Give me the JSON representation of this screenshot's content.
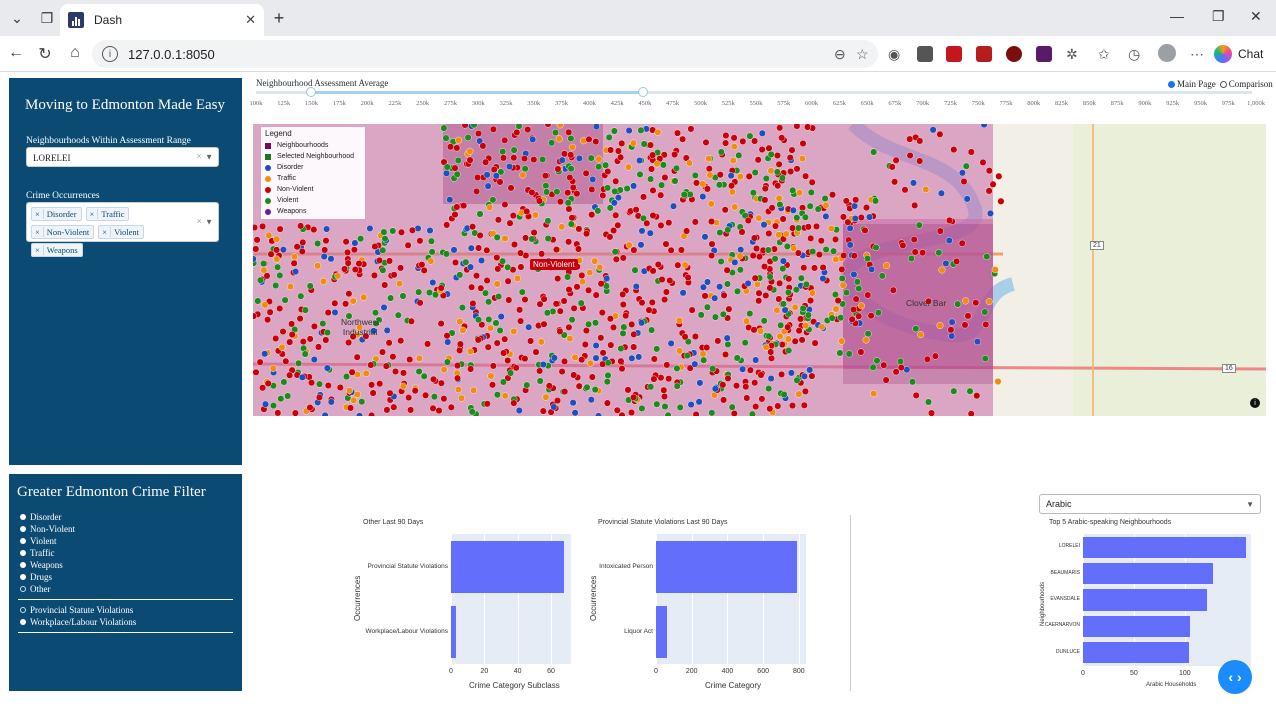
{
  "browser": {
    "tab_title": "Dash",
    "url": "127.0.0.1:8050",
    "chat_label": "Chat"
  },
  "sidebar": {
    "title": "Moving to Edmonton Made Easy",
    "range_label": "Neighbourhoods Within Assessment Range",
    "neighbourhood_value": "LORELEI",
    "crime_label": "Crime Occurrences",
    "crime_chips": [
      "Disorder",
      "Traffic",
      "Non-Violent",
      "Violent",
      "Weapons"
    ]
  },
  "filter": {
    "title": "Greater Edmonton Crime Filter",
    "options": [
      {
        "label": "Disorder",
        "selected": false
      },
      {
        "label": "Non-Violent",
        "selected": false
      },
      {
        "label": "Violent",
        "selected": false
      },
      {
        "label": "Traffic",
        "selected": false
      },
      {
        "label": "Weapons",
        "selected": false
      },
      {
        "label": "Drugs",
        "selected": false
      },
      {
        "label": "Other",
        "selected": true
      }
    ],
    "sub_options": [
      {
        "label": "Provincial Statute Violations",
        "selected": true
      },
      {
        "label": "Workplace/Labour Violations",
        "selected": false
      }
    ]
  },
  "slider": {
    "title": "Neighbourhood Assessment Average",
    "ticks": [
      "100k",
      "125k",
      "150k",
      "175k",
      "200k",
      "225k",
      "250k",
      "275k",
      "300k",
      "325k",
      "350k",
      "375k",
      "400k",
      "425k",
      "450k",
      "475k",
      "500k",
      "525k",
      "550k",
      "575k",
      "600k",
      "625k",
      "650k",
      "675k",
      "700k",
      "725k",
      "750k",
      "775k",
      "800k",
      "825k",
      "850k",
      "875k",
      "900k",
      "925k",
      "950k",
      "975k",
      "1,000k"
    ],
    "value_low": "150k",
    "value_high": "450k"
  },
  "modes": {
    "main": "Main Page",
    "comparison": "Comparison",
    "selected": "main"
  },
  "map": {
    "legend_title": "Legend",
    "legend": [
      {
        "label": "Neighbourhoods",
        "color": "#7a0a55",
        "shape": "square"
      },
      {
        "label": "Selected Neighbourhood",
        "color": "#1a7a1a",
        "shape": "square"
      },
      {
        "label": "Disorder",
        "color": "#1f4fbf",
        "shape": "circle"
      },
      {
        "label": "Traffic",
        "color": "#f28c0f",
        "shape": "circle"
      },
      {
        "label": "Non-Violent",
        "color": "#c7000a",
        "shape": "circle"
      },
      {
        "label": "Violent",
        "color": "#1c8a1c",
        "shape": "circle"
      },
      {
        "label": "Weapons",
        "color": "#6a1b9a",
        "shape": "circle"
      }
    ],
    "hover_label": "Non-Violent",
    "places": [
      "Northwest\nIndustrial",
      "Clover Bar"
    ],
    "shields": [
      "21",
      "16"
    ]
  },
  "chart_data": [
    {
      "type": "bar",
      "orientation": "horizontal",
      "title": "Other Last 90 Days",
      "categories": [
        "Provincial Statute Violations",
        "Workplace/Labour Violations"
      ],
      "values": [
        68,
        3
      ],
      "xlabel": "Crime Category Subclass",
      "ylabel": "Occurrences",
      "xticks": [
        "0",
        "20",
        "40",
        "60"
      ],
      "xlim": [
        0,
        72
      ],
      "color": "#636efa"
    },
    {
      "type": "bar",
      "orientation": "horizontal",
      "title": "Provincial Statute Violations Last 90 Days",
      "categories": [
        "Intoxicated Person",
        "Liquor Act"
      ],
      "values": [
        790,
        60
      ],
      "xlabel": "Crime Category",
      "ylabel": "Occurrences",
      "xticks": [
        "0",
        "200",
        "400",
        "600",
        "800"
      ],
      "xlim": [
        0,
        840
      ],
      "color": "#636efa"
    },
    {
      "type": "bar",
      "orientation": "horizontal",
      "title": "Top 5 Arabic-speaking Neighbourhoods",
      "categories": [
        "LORELEI",
        "BEAUMARIS",
        "EVANSDALE",
        "CAERNARVON",
        "DUNLUCE"
      ],
      "values": [
        160,
        128,
        122,
        105,
        104
      ],
      "xlabel": "Arabic Households",
      "ylabel": "Neighbourhoods",
      "xticks": [
        "0",
        "50",
        "100"
      ],
      "xlim": [
        0,
        165
      ],
      "color": "#636efa"
    }
  ],
  "language_select": {
    "value": "Arabic"
  },
  "colors": {
    "panel": "#0b4a73",
    "bar": "#636efa",
    "plot_bg": "#e5ecf6"
  }
}
